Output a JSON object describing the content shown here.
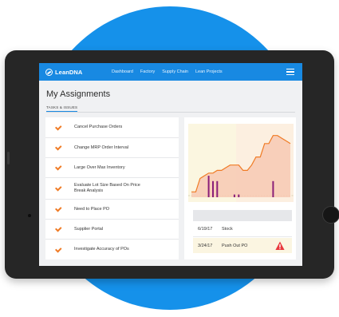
{
  "nav": {
    "logo": "LeanDNA",
    "links": [
      "Dashboard",
      "Factory",
      "Supply Chain",
      "Lean Projects"
    ]
  },
  "page": {
    "title": "My Assignments",
    "tab": "TASKS & ISSUES"
  },
  "tasks": [
    {
      "line1": "Cancel Purchase Orders",
      "line2": ""
    },
    {
      "line1": "Change MRP Order Interval",
      "line2": ""
    },
    {
      "line1": "Large Over Max Inventory",
      "line2": ""
    },
    {
      "line1": "Evaluate Lot Size Based On Price",
      "line2": "Break Analysis"
    },
    {
      "line1": "Need to Place PO",
      "line2": ""
    },
    {
      "line1": "Supplier Portal",
      "line2": ""
    },
    {
      "line1": "Investigate Accuracy of POs",
      "line2": ""
    }
  ],
  "table": {
    "rows": [
      {
        "date": "6/19/17",
        "label": "Stock",
        "warning": false
      },
      {
        "date": "3/24/17",
        "label": "Push Out PO",
        "warning": true
      }
    ]
  },
  "colors": {
    "accent": "#1889e2",
    "check": "#f07b25",
    "line": "#f07b25",
    "bars": "#8a1f78",
    "warning": "#e8383d"
  },
  "chart_data": {
    "type": "line",
    "x": [
      0,
      1,
      2,
      3,
      4,
      5,
      6,
      7,
      8,
      9,
      10,
      11,
      12,
      13,
      14,
      15,
      16,
      17,
      18,
      19,
      20,
      21,
      22,
      23
    ],
    "series": [
      {
        "values": [
          2,
          2,
          7,
          8,
          9,
          9,
          10,
          10,
          11,
          12,
          12,
          12,
          10,
          10,
          12,
          15,
          15,
          20,
          20,
          23,
          23,
          22,
          21,
          20
        ]
      }
    ],
    "bars": [
      {
        "x": 4,
        "value": 8
      },
      {
        "x": 5,
        "value": 6
      },
      {
        "x": 6,
        "value": 6
      },
      {
        "x": 10,
        "value": 1
      },
      {
        "x": 11,
        "value": 1
      },
      {
        "x": 19,
        "value": 6
      }
    ],
    "ylim": [
      0,
      25
    ],
    "grid": false
  }
}
